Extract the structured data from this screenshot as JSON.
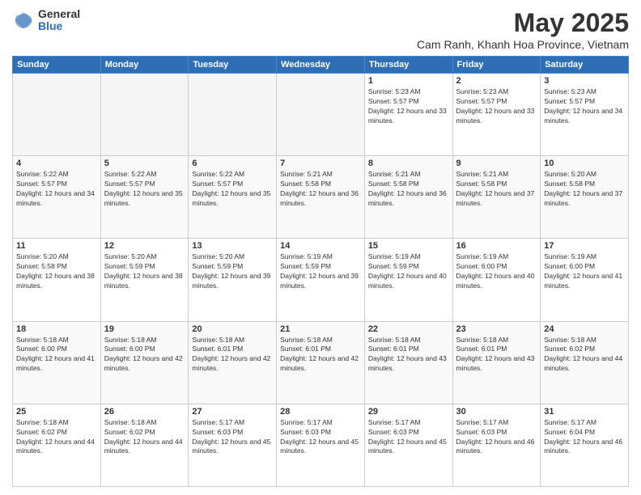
{
  "header": {
    "logo_general": "General",
    "logo_blue": "Blue",
    "month_title": "May 2025",
    "location": "Cam Ranh, Khanh Hoa Province, Vietnam"
  },
  "days_of_week": [
    "Sunday",
    "Monday",
    "Tuesday",
    "Wednesday",
    "Thursday",
    "Friday",
    "Saturday"
  ],
  "weeks": [
    [
      {
        "day": "",
        "empty": true
      },
      {
        "day": "",
        "empty": true
      },
      {
        "day": "",
        "empty": true
      },
      {
        "day": "",
        "empty": true
      },
      {
        "day": "1",
        "sunrise": "5:23 AM",
        "sunset": "5:57 PM",
        "daylight": "12 hours and 33 minutes."
      },
      {
        "day": "2",
        "sunrise": "5:23 AM",
        "sunset": "5:57 PM",
        "daylight": "12 hours and 33 minutes."
      },
      {
        "day": "3",
        "sunrise": "5:23 AM",
        "sunset": "5:57 PM",
        "daylight": "12 hours and 34 minutes."
      }
    ],
    [
      {
        "day": "4",
        "sunrise": "5:22 AM",
        "sunset": "5:57 PM",
        "daylight": "12 hours and 34 minutes."
      },
      {
        "day": "5",
        "sunrise": "5:22 AM",
        "sunset": "5:57 PM",
        "daylight": "12 hours and 35 minutes."
      },
      {
        "day": "6",
        "sunrise": "5:22 AM",
        "sunset": "5:57 PM",
        "daylight": "12 hours and 35 minutes."
      },
      {
        "day": "7",
        "sunrise": "5:21 AM",
        "sunset": "5:58 PM",
        "daylight": "12 hours and 36 minutes."
      },
      {
        "day": "8",
        "sunrise": "5:21 AM",
        "sunset": "5:58 PM",
        "daylight": "12 hours and 36 minutes."
      },
      {
        "day": "9",
        "sunrise": "5:21 AM",
        "sunset": "5:58 PM",
        "daylight": "12 hours and 37 minutes."
      },
      {
        "day": "10",
        "sunrise": "5:20 AM",
        "sunset": "5:58 PM",
        "daylight": "12 hours and 37 minutes."
      }
    ],
    [
      {
        "day": "11",
        "sunrise": "5:20 AM",
        "sunset": "5:58 PM",
        "daylight": "12 hours and 38 minutes."
      },
      {
        "day": "12",
        "sunrise": "5:20 AM",
        "sunset": "5:59 PM",
        "daylight": "12 hours and 38 minutes."
      },
      {
        "day": "13",
        "sunrise": "5:20 AM",
        "sunset": "5:59 PM",
        "daylight": "12 hours and 39 minutes."
      },
      {
        "day": "14",
        "sunrise": "5:19 AM",
        "sunset": "5:59 PM",
        "daylight": "12 hours and 39 minutes."
      },
      {
        "day": "15",
        "sunrise": "5:19 AM",
        "sunset": "5:59 PM",
        "daylight": "12 hours and 40 minutes."
      },
      {
        "day": "16",
        "sunrise": "5:19 AM",
        "sunset": "6:00 PM",
        "daylight": "12 hours and 40 minutes."
      },
      {
        "day": "17",
        "sunrise": "5:19 AM",
        "sunset": "6:00 PM",
        "daylight": "12 hours and 41 minutes."
      }
    ],
    [
      {
        "day": "18",
        "sunrise": "5:18 AM",
        "sunset": "6:00 PM",
        "daylight": "12 hours and 41 minutes."
      },
      {
        "day": "19",
        "sunrise": "5:18 AM",
        "sunset": "6:00 PM",
        "daylight": "12 hours and 42 minutes."
      },
      {
        "day": "20",
        "sunrise": "5:18 AM",
        "sunset": "6:01 PM",
        "daylight": "12 hours and 42 minutes."
      },
      {
        "day": "21",
        "sunrise": "5:18 AM",
        "sunset": "6:01 PM",
        "daylight": "12 hours and 42 minutes."
      },
      {
        "day": "22",
        "sunrise": "5:18 AM",
        "sunset": "6:01 PM",
        "daylight": "12 hours and 43 minutes."
      },
      {
        "day": "23",
        "sunrise": "5:18 AM",
        "sunset": "6:01 PM",
        "daylight": "12 hours and 43 minutes."
      },
      {
        "day": "24",
        "sunrise": "5:18 AM",
        "sunset": "6:02 PM",
        "daylight": "12 hours and 44 minutes."
      }
    ],
    [
      {
        "day": "25",
        "sunrise": "5:18 AM",
        "sunset": "6:02 PM",
        "daylight": "12 hours and 44 minutes."
      },
      {
        "day": "26",
        "sunrise": "5:18 AM",
        "sunset": "6:02 PM",
        "daylight": "12 hours and 44 minutes."
      },
      {
        "day": "27",
        "sunrise": "5:17 AM",
        "sunset": "6:03 PM",
        "daylight": "12 hours and 45 minutes."
      },
      {
        "day": "28",
        "sunrise": "5:17 AM",
        "sunset": "6:03 PM",
        "daylight": "12 hours and 45 minutes."
      },
      {
        "day": "29",
        "sunrise": "5:17 AM",
        "sunset": "6:03 PM",
        "daylight": "12 hours and 45 minutes."
      },
      {
        "day": "30",
        "sunrise": "5:17 AM",
        "sunset": "6:03 PM",
        "daylight": "12 hours and 46 minutes."
      },
      {
        "day": "31",
        "sunrise": "5:17 AM",
        "sunset": "6:04 PM",
        "daylight": "12 hours and 46 minutes."
      }
    ]
  ],
  "labels": {
    "sunrise_prefix": "Sunrise: ",
    "sunset_prefix": "Sunset: ",
    "daylight_label": "Daylight: "
  }
}
